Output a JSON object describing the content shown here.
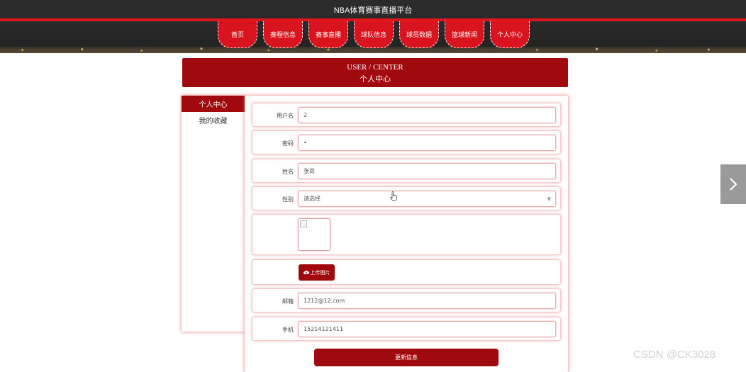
{
  "header": {
    "site_title": "NBA体育赛事直播平台"
  },
  "nav": {
    "items": [
      {
        "label": "首页"
      },
      {
        "label": "赛程信息"
      },
      {
        "label": "赛事直播"
      },
      {
        "label": "球队信息"
      },
      {
        "label": "球员数据"
      },
      {
        "label": "篮球新闻"
      },
      {
        "label": "个人中心"
      }
    ]
  },
  "banner": {
    "title_en": "USER / CENTER",
    "title_cn": "个人中心"
  },
  "sidebar": {
    "items": [
      {
        "label": "个人中心",
        "active": true
      },
      {
        "label": "我的收藏",
        "active": false
      }
    ]
  },
  "form": {
    "username": {
      "label": "用户名",
      "value": "2"
    },
    "password": {
      "label": "密码",
      "value": "•"
    },
    "name": {
      "label": "姓名",
      "value": "张尚"
    },
    "gender": {
      "label": "性别",
      "placeholder": "请选择"
    },
    "upload_label": "上传图片",
    "email": {
      "label": "邮箱",
      "value": "1212@12.com"
    },
    "phone": {
      "label": "手机",
      "value": "15214121411"
    },
    "submit_label": "更新信息"
  },
  "icons": {
    "upload": "cloud-upload-icon",
    "next": "chevron-right-icon",
    "cursor": "hand-pointer-icon"
  },
  "colors": {
    "primary": "#a0090e",
    "accent": "#e0161f",
    "topbar": "#2b2b2b"
  },
  "watermark": "CSDN @CK3028"
}
